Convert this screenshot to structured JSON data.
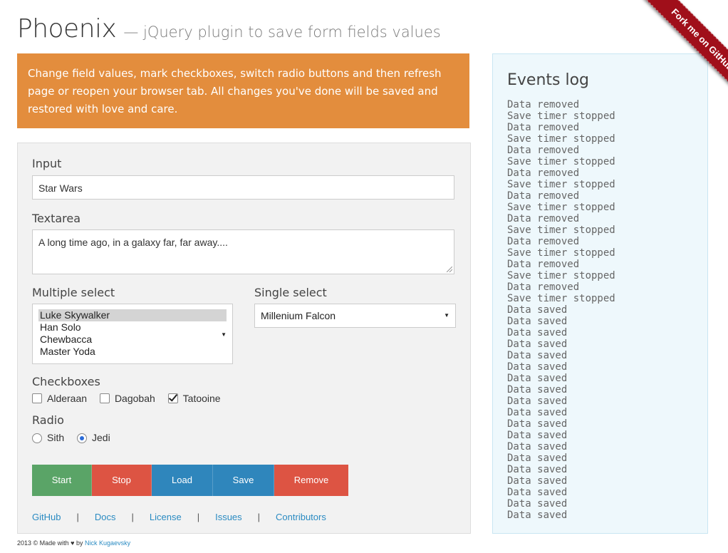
{
  "header": {
    "title": "Phoenix",
    "subtitle": "— jQuery plugin to save form fields values"
  },
  "intro": {
    "text": "Change field values, mark checkboxes, switch radio buttons and then refresh page or reopen your browser tab. All changes you've done will be saved and restored with love and care."
  },
  "form": {
    "input_label": "Input",
    "input_value": "Star Wars",
    "textarea_label": "Textarea",
    "textarea_value": "A long time ago, in a galaxy far, far away....",
    "multi_select_label": "Multiple select",
    "multi_select_options": [
      "Luke Skywalker",
      "Han Solo",
      "Chewbacca",
      "Master Yoda"
    ],
    "multi_select_selected": "Luke Skywalker",
    "single_select_label": "Single select",
    "single_select_value": "Millenium Falcon",
    "checkboxes_label": "Checkboxes",
    "checkboxes": [
      {
        "label": "Alderaan",
        "checked": false
      },
      {
        "label": "Dagobah",
        "checked": false
      },
      {
        "label": "Tatooine",
        "checked": true
      }
    ],
    "radio_label": "Radio",
    "radios": [
      {
        "label": "Sith",
        "checked": false
      },
      {
        "label": "Jedi",
        "checked": true
      }
    ]
  },
  "buttons": [
    {
      "label": "Start",
      "color": "#5aa467"
    },
    {
      "label": "Stop",
      "color": "#dd5443"
    },
    {
      "label": "Load",
      "color": "#2f86bc"
    },
    {
      "label": "Save",
      "color": "#2f86bc"
    },
    {
      "label": "Remove",
      "color": "#dd5443"
    }
  ],
  "links": [
    "GitHub",
    "Docs",
    "License",
    "Issues",
    "Contributors"
  ],
  "footer": {
    "text": "2013 © Made with ♥ by",
    "author": "Nick Kugaevsky"
  },
  "log": {
    "title": "Events log",
    "entries": [
      "Data removed",
      "Save timer stopped",
      "Data removed",
      "Save timer stopped",
      "Data removed",
      "Save timer stopped",
      "Data removed",
      "Save timer stopped",
      "Data removed",
      "Save timer stopped",
      "Data removed",
      "Save timer stopped",
      "Data removed",
      "Save timer stopped",
      "Data removed",
      "Save timer stopped",
      "Data removed",
      "Save timer stopped",
      "Data saved",
      "Data saved",
      "Data saved",
      "Data saved",
      "Data saved",
      "Data saved",
      "Data saved",
      "Data saved",
      "Data saved",
      "Data saved",
      "Data saved",
      "Data saved",
      "Data saved",
      "Data saved",
      "Data saved",
      "Data saved",
      "Data saved",
      "Data saved",
      "Data saved"
    ]
  },
  "ribbon": {
    "text": "Fork me on GitHub",
    "color": "#a00f1a"
  },
  "colors": {
    "intro_bg": "#e38d3d",
    "link": "#2a8bc2",
    "log_bg": "#eef8fc"
  }
}
